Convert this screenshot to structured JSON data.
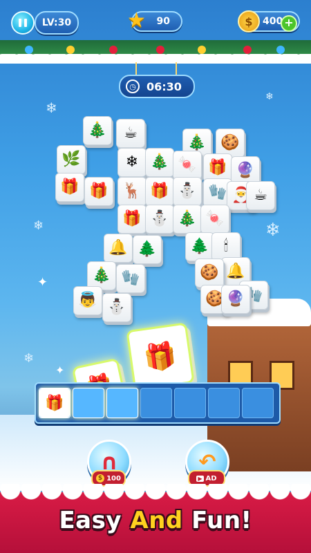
{
  "hud": {
    "level_label": "LV:30",
    "stars": "90",
    "coins": "400",
    "timer": "06:30"
  },
  "tiles": [
    {
      "icon": "wreath-icon",
      "glyph": "🎄"
    },
    {
      "icon": "hot-cocoa-icon",
      "glyph": "☕"
    },
    {
      "icon": "wreath-icon",
      "glyph": "🎄"
    },
    {
      "icon": "gingerbread-icon",
      "glyph": "🍪"
    },
    {
      "icon": "holly-icon",
      "glyph": "🌿"
    },
    {
      "icon": "snowflake-icon",
      "glyph": "❄"
    },
    {
      "icon": "wreath-icon",
      "glyph": "🎄"
    },
    {
      "icon": "candy-cane-icon",
      "glyph": "🍬"
    },
    {
      "icon": "gift-box-icon",
      "glyph": "🎁"
    },
    {
      "icon": "ornament-icon",
      "glyph": "🔮"
    },
    {
      "icon": "gift-box-icon",
      "glyph": "🎁"
    },
    {
      "icon": "gift-box-icon",
      "glyph": "🎁"
    },
    {
      "icon": "reindeer-icon",
      "glyph": "🦌"
    },
    {
      "icon": "gift-box-icon",
      "glyph": "🎁"
    },
    {
      "icon": "snow-globe-icon",
      "glyph": "⛄"
    },
    {
      "icon": "mitten-icon",
      "glyph": "🧤"
    },
    {
      "icon": "santa-icon",
      "glyph": "🎅"
    },
    {
      "icon": "hot-cocoa-icon",
      "glyph": "☕"
    },
    {
      "icon": "gift-box-icon",
      "glyph": "🎁"
    },
    {
      "icon": "snowman-icon",
      "glyph": "⛄"
    },
    {
      "icon": "wreath-icon",
      "glyph": "🎄"
    },
    {
      "icon": "candy-cane-icon",
      "glyph": "🍬"
    },
    {
      "icon": "bell-icon",
      "glyph": "🔔"
    },
    {
      "icon": "christmas-tree-icon",
      "glyph": "🌲"
    },
    {
      "icon": "christmas-tree-icon",
      "glyph": "🌲"
    },
    {
      "icon": "candle-icon",
      "glyph": "🕯"
    },
    {
      "icon": "wreath-icon",
      "glyph": "🎄"
    },
    {
      "icon": "mitten-icon",
      "glyph": "🧤"
    },
    {
      "icon": "gingerbread-icon",
      "glyph": "🍪"
    },
    {
      "icon": "bell-icon",
      "glyph": "🔔"
    },
    {
      "icon": "angel-icon",
      "glyph": "👼"
    },
    {
      "icon": "snow-globe-icon",
      "glyph": "⛄"
    },
    {
      "icon": "gingerbread-icon",
      "glyph": "🍪"
    },
    {
      "icon": "ornament-icon",
      "glyph": "🔮"
    },
    {
      "icon": "mitten-icon",
      "glyph": "🧤"
    }
  ],
  "tray": {
    "slots": 7,
    "filled": 1
  },
  "boosters": {
    "magnet_cost": "100",
    "undo_label": "AD"
  },
  "banner": {
    "part1": "Easy",
    "part2": "And",
    "part3": "Fun!"
  },
  "colors": {
    "accent_blue": "#1f5fb2",
    "banner_red": "#d81b45",
    "highlight_yellow": "#ffd21f"
  }
}
